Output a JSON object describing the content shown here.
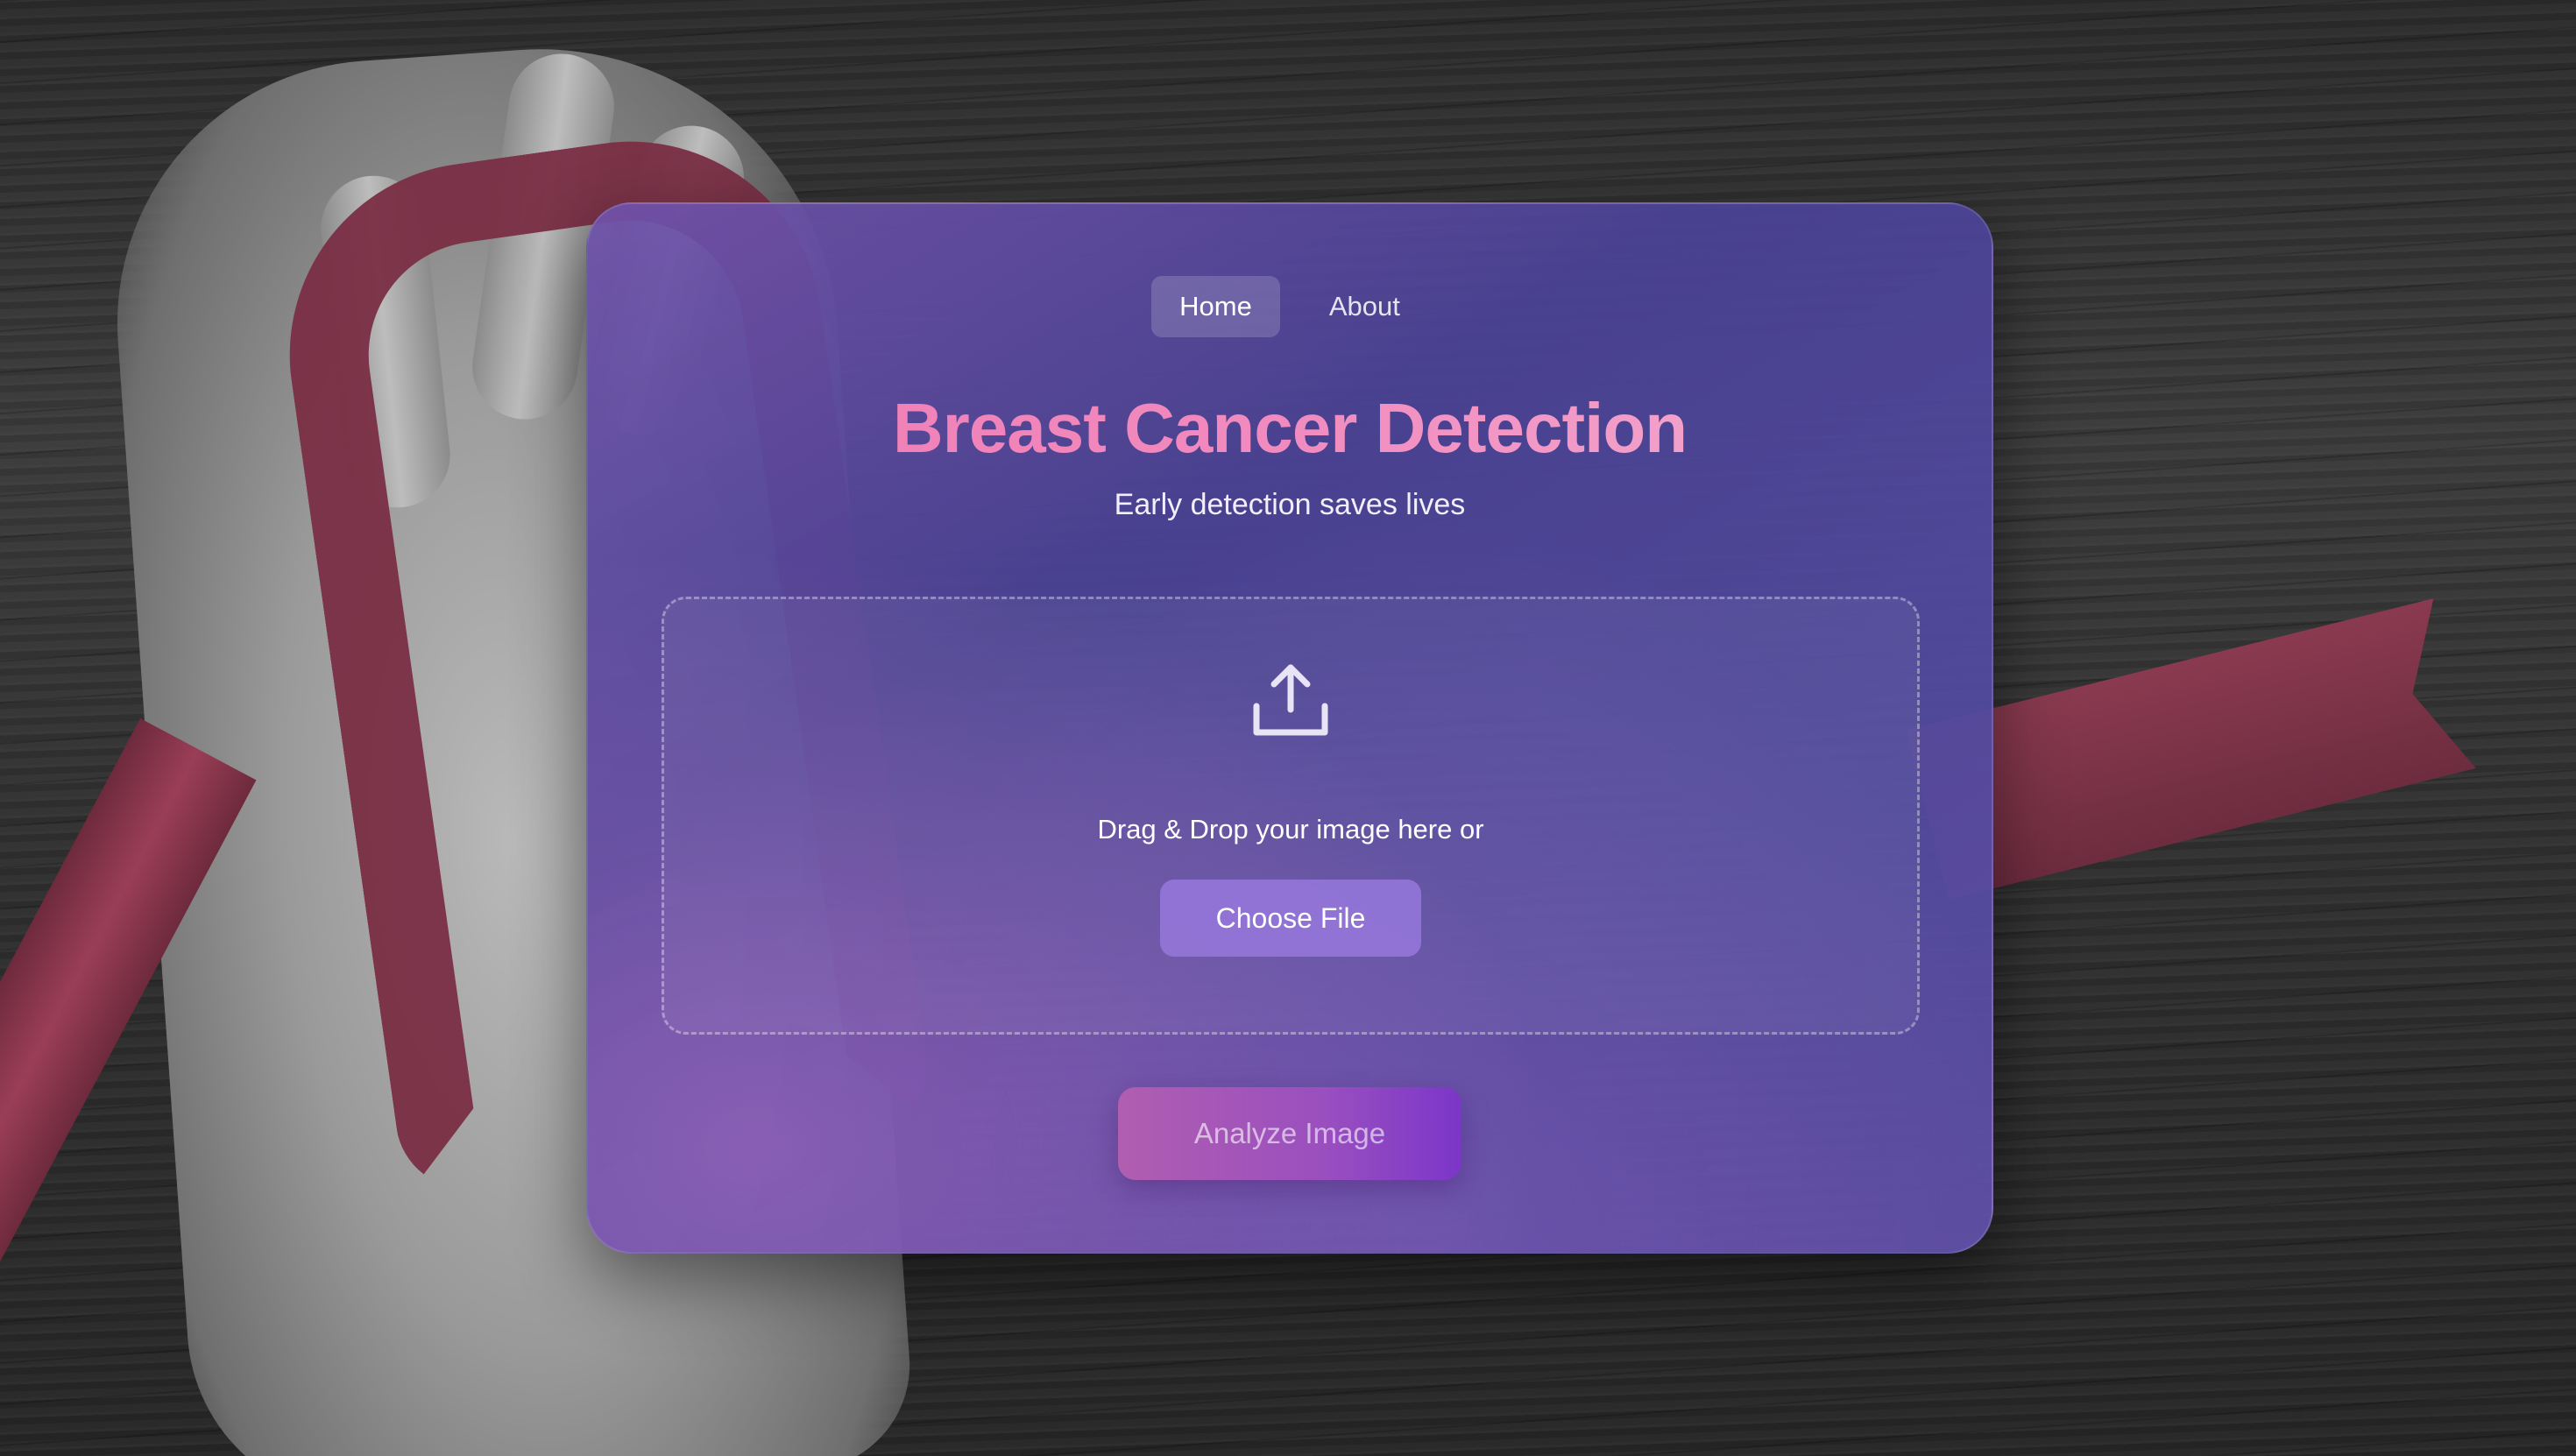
{
  "nav": {
    "items": [
      {
        "label": "Home",
        "active": true
      },
      {
        "label": "About",
        "active": false
      }
    ]
  },
  "header": {
    "title": "Breast Cancer Detection",
    "subtitle": "Early detection saves lives"
  },
  "upload": {
    "icon": "upload-icon",
    "prompt": "Drag & Drop your image here or",
    "choose_label": "Choose File"
  },
  "actions": {
    "analyze_label": "Analyze Image"
  },
  "colors": {
    "title_gradient_start": "#f07bb3",
    "title_gradient_end": "#f4b0d2",
    "card": "#4a4294",
    "analyze_gradient_start": "#b05eb0",
    "analyze_gradient_end": "#7b36c9"
  }
}
